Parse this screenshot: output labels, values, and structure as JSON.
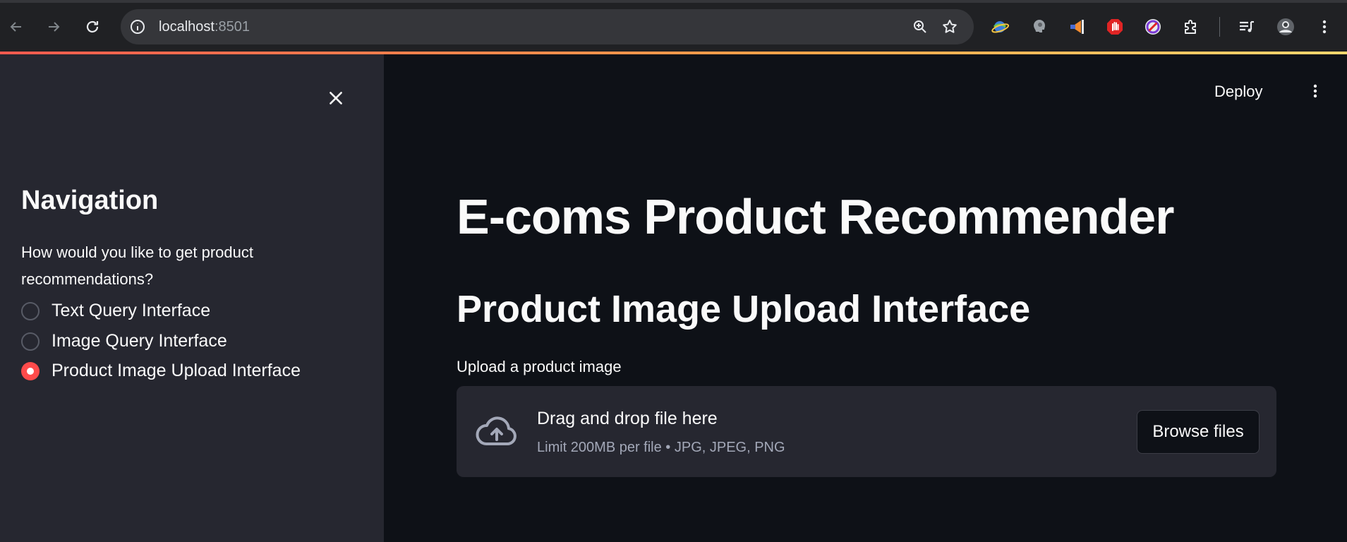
{
  "browser": {
    "url_host": "localhost",
    "url_port": ":8501",
    "icons": [
      "back-icon",
      "forward-icon",
      "reload-icon",
      "site-info-icon",
      "zoom-icon",
      "bookmark-star-icon"
    ],
    "extensions": [
      "globe-extension-icon",
      "head-extension-icon",
      "megaphone-extension-icon",
      "stop-hand-extension-icon",
      "blocked-circle-extension-icon",
      "puzzle-extensions-icon",
      "media-queue-icon",
      "profile-avatar-icon",
      "browser-menu-icon"
    ]
  },
  "sidebar": {
    "title": "Navigation",
    "question": "How would you like to get product recommendations?",
    "options": [
      {
        "label": "Text Query Interface",
        "checked": false
      },
      {
        "label": "Image Query Interface",
        "checked": false
      },
      {
        "label": "Product Image Upload Interface",
        "checked": true
      }
    ]
  },
  "header": {
    "deploy_label": "Deploy"
  },
  "main": {
    "title": "E-coms Product Recommender",
    "subtitle": "Product Image Upload Interface",
    "upload_label": "Upload a product image",
    "dropzone": {
      "title": "Drag and drop file here",
      "limit": "Limit 200MB per file • JPG, JPEG, PNG",
      "browse_label": "Browse files"
    }
  },
  "colors": {
    "accent": "#ff4b4b",
    "sidebar_bg": "#262730",
    "main_bg": "#0e1117",
    "text": "#fafafa"
  }
}
